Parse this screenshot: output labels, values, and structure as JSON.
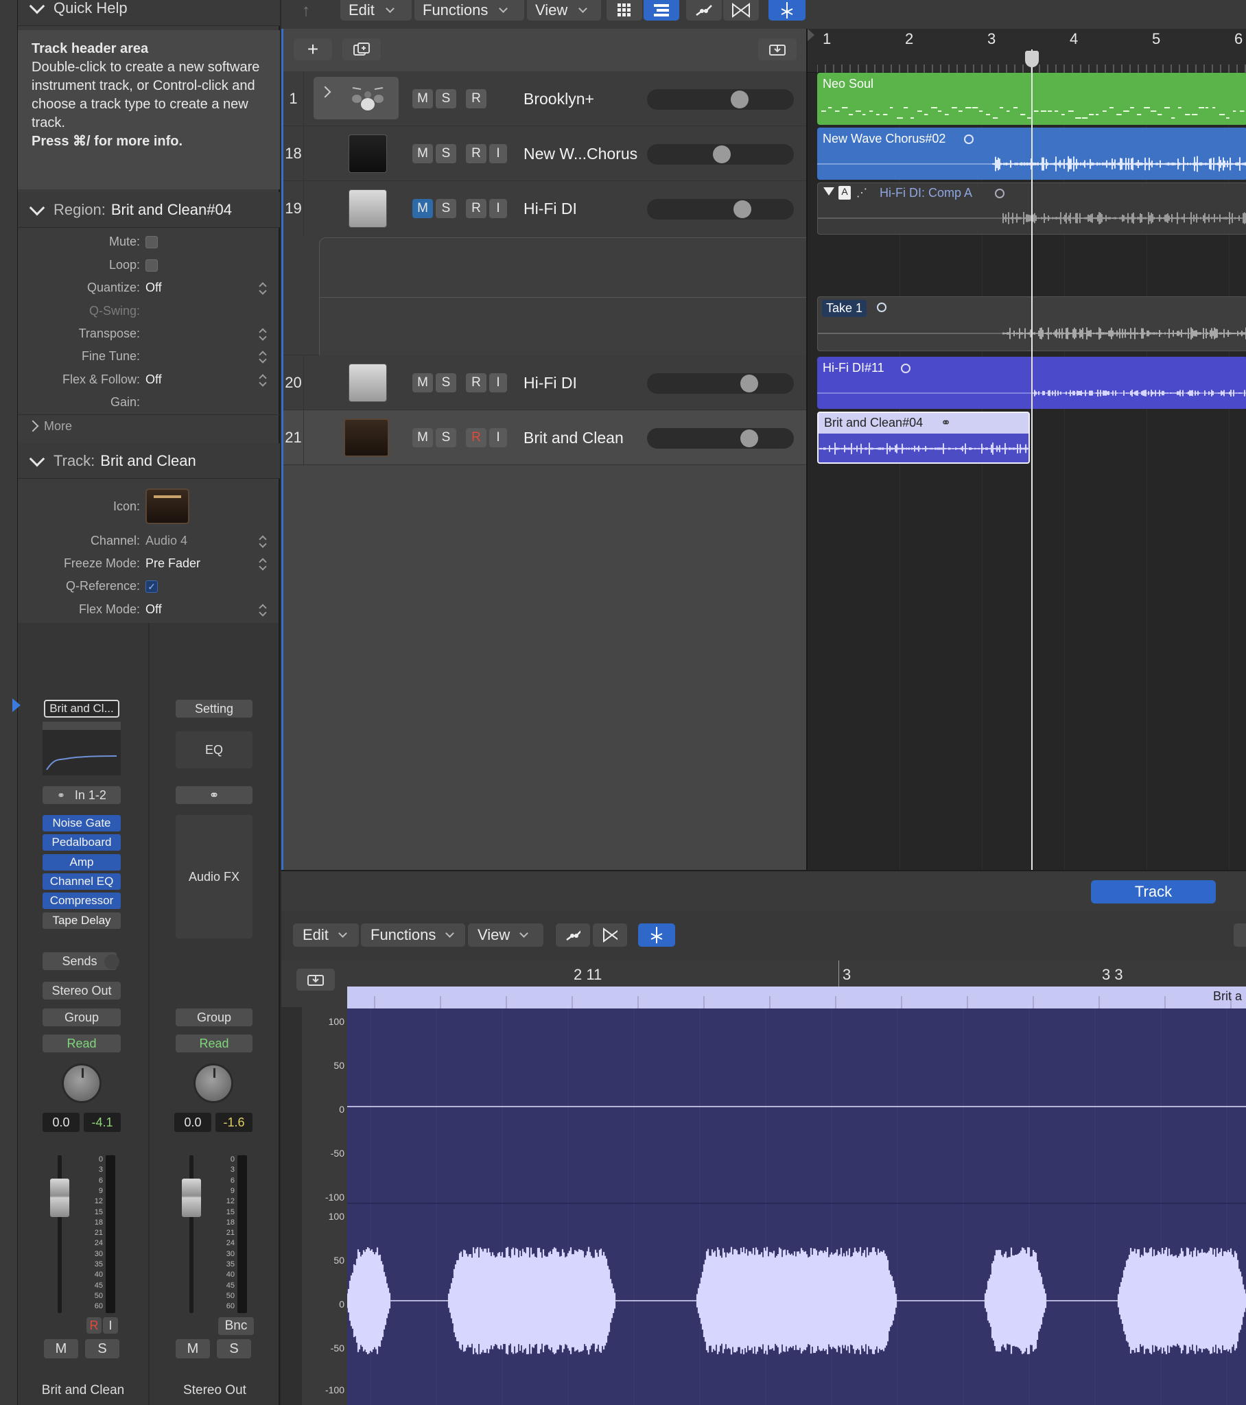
{
  "quick_help": {
    "title": "Quick Help",
    "heading": "Track header area",
    "body": "Double-click to create a new software instrument track, or Control-click and choose a track type to create a new track.",
    "more": "Press ⌘/ for more info."
  },
  "region_inspector": {
    "key": "Region:",
    "name": "Brit and Clean#04",
    "rows": [
      {
        "label": "Mute:",
        "value": ""
      },
      {
        "label": "Loop:",
        "value": ""
      },
      {
        "label": "Quantize:",
        "value": "Off"
      },
      {
        "label": "Q-Swing:",
        "value": ""
      },
      {
        "label": "Transpose:",
        "value": ""
      },
      {
        "label": "Fine Tune:",
        "value": ""
      },
      {
        "label": "Flex & Follow:",
        "value": "Off"
      },
      {
        "label": "Gain:",
        "value": ""
      }
    ],
    "more": "More"
  },
  "track_inspector": {
    "key": "Track:",
    "name": "Brit and Clean",
    "rows": [
      {
        "label": "Icon:",
        "value": ""
      },
      {
        "label": "Channel:",
        "value": "Audio 4"
      },
      {
        "label": "Freeze Mode:",
        "value": "Pre Fader"
      },
      {
        "label": "Q-Reference:",
        "value": "✓"
      },
      {
        "label": "Flex Mode:",
        "value": "Off"
      }
    ]
  },
  "strips": [
    {
      "setting": "Brit and Cl...",
      "input": "In 1-2",
      "plugins": [
        "Noise Gate",
        "Pedalboard",
        "Amp",
        "Channel EQ",
        "Compressor",
        "Tape Delay"
      ],
      "sends": "Sends",
      "output": "Stereo Out",
      "group": "Group",
      "automation": "Read",
      "volume": "0.0",
      "peak": "-4.1",
      "r": "R",
      "i": "I",
      "m": "M",
      "s": "S",
      "name": "Brit and Clean"
    },
    {
      "setting": "Setting",
      "eq": "EQ",
      "audio_fx": "Audio FX",
      "group": "Group",
      "automation": "Read",
      "volume": "0.0",
      "peak": "-1.6",
      "bnc": "Bnc",
      "m": "M",
      "s": "S",
      "name": "Stereo Out"
    }
  ],
  "meter_scale": [
    "0",
    "3",
    "6",
    "9",
    "12",
    "15",
    "18",
    "21",
    "24",
    "30",
    "35",
    "40",
    "45",
    "50",
    "60"
  ],
  "toolbar": {
    "edit": "Edit",
    "functions": "Functions",
    "view": "View"
  },
  "ruler": [
    "1",
    "2",
    "3",
    "4",
    "5",
    "6"
  ],
  "tracks": [
    {
      "num": "1",
      "name": "Brooklyn+",
      "m": "M",
      "s": "S",
      "r": "R"
    },
    {
      "num": "18",
      "name": "New W...Chorus",
      "m": "M",
      "s": "S",
      "r": "R",
      "i": "I"
    },
    {
      "num": "19",
      "name": "Hi-Fi DI",
      "m": "M",
      "s": "S",
      "r": "R",
      "i": "I"
    },
    {
      "num": "20",
      "name": "Hi-Fi DI",
      "m": "M",
      "s": "S",
      "r": "R",
      "i": "I"
    },
    {
      "num": "21",
      "name": "Brit and Clean",
      "m": "M",
      "s": "S",
      "r": "R",
      "i": "I"
    }
  ],
  "regions": {
    "neo_soul": "Neo Soul",
    "chorus": "New Wave Chorus#02",
    "comp_a": "A",
    "comp": "Hi-Fi DI: Comp A",
    "take": "Take 1",
    "hifi11": "Hi-Fi DI#11",
    "brit": "Brit and Clean#04"
  },
  "editor": {
    "tab": "Track",
    "edit": "Edit",
    "functions": "Functions",
    "view": "View",
    "ruler": [
      "2 11",
      "3",
      "3 3"
    ],
    "lane_label": "Brit a",
    "y_labels_top": [
      "100",
      "50",
      "0",
      "-50",
      "-100"
    ],
    "y_labels_bottom": [
      "100",
      "50",
      "0",
      "-50",
      "-100"
    ]
  },
  "colors": {
    "accent": "#2f68c9",
    "neo_soul": "#5bb449",
    "chorus": "#3e72c4",
    "hifi": "#4a4acb",
    "brit_region": "#4c4cc4",
    "editor_bg": "#343468",
    "wave": "#d6d6ff"
  }
}
